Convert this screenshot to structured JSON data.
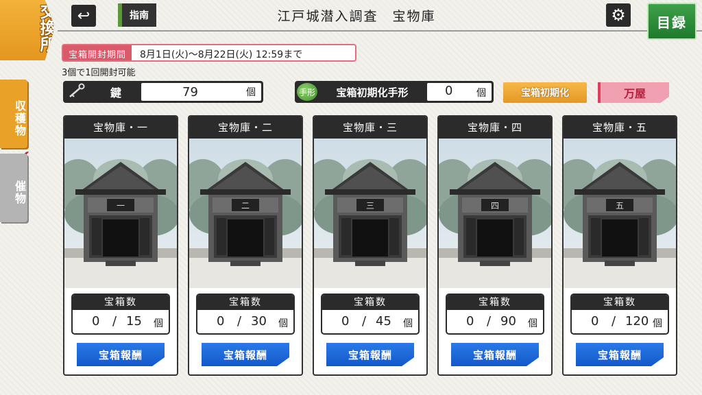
{
  "header": {
    "corner_tab": "交換所",
    "back_icon": "↩",
    "guide_label": "指南",
    "title": "江戸城潜入調査　宝物庫",
    "gear_icon": "⚙",
    "catalog_label": "目録"
  },
  "side_tabs": [
    {
      "label": "収穫物",
      "active": true
    },
    {
      "label": "催物",
      "active": false
    }
  ],
  "period": {
    "label": "宝箱開封期間",
    "value": "8月1日(火)〜8月22日(火) 12:59まで"
  },
  "note": "3個で1回開封可能",
  "key": {
    "label": "鍵",
    "value": "79",
    "unit": "個"
  },
  "reset_ticket": {
    "icon_text": "手形",
    "label": "宝箱初期化手形",
    "value": "0",
    "unit": "個"
  },
  "reset_button": "宝箱初期化",
  "shop_button": "万屋",
  "vaults": [
    {
      "name": "宝物庫・一",
      "plaque": "一",
      "count_label": "宝箱数",
      "current": "0",
      "max": "15",
      "unit": "個",
      "reward_label": "宝箱報酬"
    },
    {
      "name": "宝物庫・二",
      "plaque": "二",
      "count_label": "宝箱数",
      "current": "0",
      "max": "30",
      "unit": "個",
      "reward_label": "宝箱報酬"
    },
    {
      "name": "宝物庫・三",
      "plaque": "三",
      "count_label": "宝箱数",
      "current": "0",
      "max": "45",
      "unit": "個",
      "reward_label": "宝箱報酬"
    },
    {
      "name": "宝物庫・四",
      "plaque": "四",
      "count_label": "宝箱数",
      "current": "0",
      "max": "90",
      "unit": "個",
      "reward_label": "宝箱報酬"
    },
    {
      "name": "宝物庫・五",
      "plaque": "五",
      "count_label": "宝箱数",
      "current": "0",
      "max": "120",
      "unit": "個",
      "reward_label": "宝箱報酬"
    }
  ],
  "colors": {
    "accent_orange": "#e9a227",
    "reward_blue": "#1a6ad8",
    "period_red": "#d95a68",
    "catalog_green": "#2a8c38"
  }
}
